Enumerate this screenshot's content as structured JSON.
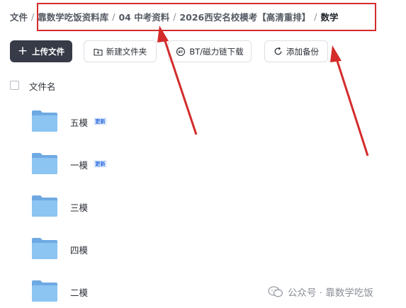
{
  "breadcrumb": {
    "items": [
      "文件",
      "靠数学吃饭资料库",
      "04 中考资料",
      "2026西安名校模考【高清重排】",
      "数学"
    ],
    "separator": "/"
  },
  "toolbar": {
    "upload_label": "上传文件",
    "new_folder_label": "新建文件夹",
    "bt_label": "BT/磁力链下载",
    "backup_label": "添加备份",
    "bt_icon_text": "BT"
  },
  "list": {
    "column_header": "文件名",
    "folders": [
      {
        "name": "五模",
        "badge": "更新"
      },
      {
        "name": "一模",
        "badge": "更新"
      },
      {
        "name": "三模",
        "badge": ""
      },
      {
        "name": "四模",
        "badge": ""
      },
      {
        "name": "二模",
        "badge": ""
      }
    ]
  },
  "watermark": {
    "text": "公众号 · 靠数学吃饭"
  },
  "colors": {
    "annotation_red": "#d42b2b",
    "primary_button": "#373b47",
    "folder_blue": "#8cc4f2",
    "badge_blue": "#2f6fe0"
  }
}
